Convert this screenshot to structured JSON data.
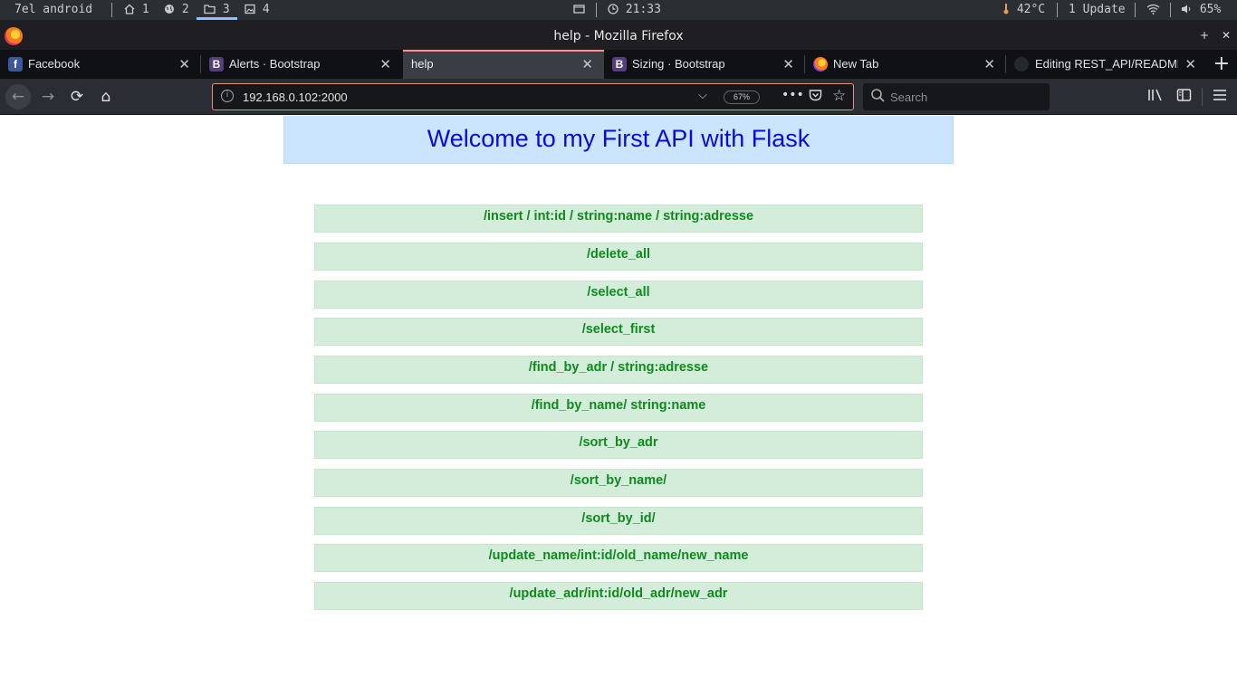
{
  "system_bar": {
    "workspace_name": "7el android",
    "workspaces": [
      "1",
      "2",
      "3",
      "4"
    ],
    "active_workspace": "3",
    "clock": "21:33",
    "temperature": "42°C",
    "updates": "1 Update",
    "volume": "65%"
  },
  "window": {
    "title": "help - Mozilla Firefox",
    "close_label": "✕"
  },
  "tabs": [
    {
      "label": "Facebook",
      "favicon": "f",
      "active": false
    },
    {
      "label": "Alerts · Bootstrap",
      "favicon": "B",
      "active": false
    },
    {
      "label": "help",
      "favicon": "",
      "active": true
    },
    {
      "label": "Sizing · Bootstrap",
      "favicon": "B",
      "active": false
    },
    {
      "label": "New Tab",
      "favicon": "firefox",
      "active": false
    },
    {
      "label": "Editing REST_API/README.m",
      "favicon": "github",
      "active": false
    }
  ],
  "toolbar": {
    "url": "192.168.0.102:2000",
    "zoom": "67%",
    "search_placeholder": "Search"
  },
  "page": {
    "heading": "Welcome to my First API with Flask",
    "routes": [
      "/insert / int:id / string:name / string:adresse",
      "/delete_all",
      "/select_all",
      "/select_first",
      "/find_by_adr / string:adresse",
      "/find_by_name/ string:name",
      "/sort_by_adr",
      "/sort_by_name/",
      "/sort_by_id/",
      "/update_name/int:id/old_name/new_name",
      "/update_adr/int:id/old_adr/new_adr"
    ]
  },
  "colors": {
    "heading_bg": "#cce5ff",
    "heading_text": "#0a0ae0",
    "route_bg": "#d4edda",
    "route_text": "#0f8a1e"
  }
}
